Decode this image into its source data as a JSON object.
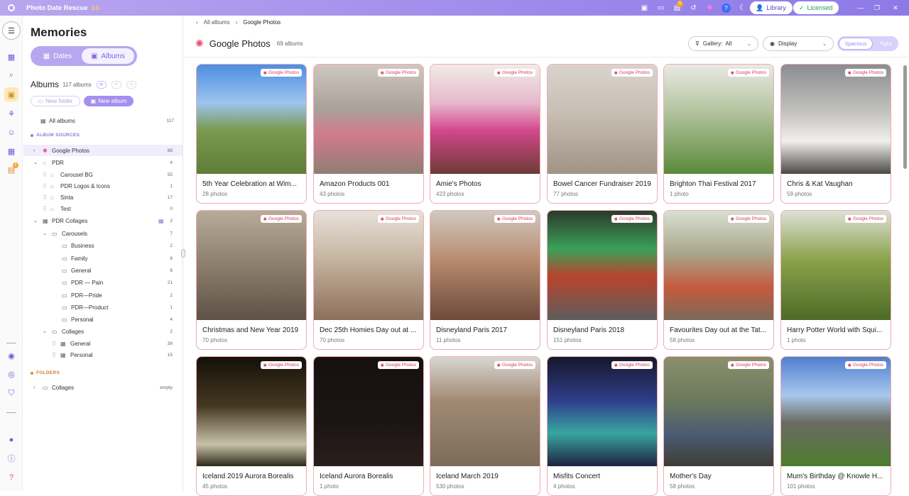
{
  "titlebar": {
    "app_name": "Photo Date Rescue",
    "version": "3.0",
    "notif_badge": "5",
    "library_label": "Library",
    "licensed_label": "Licensed"
  },
  "rail": {
    "badge": "5"
  },
  "sidebar": {
    "title": "Memories",
    "seg_dates": "Dates",
    "seg_albums": "Albums",
    "albums_title": "Albums",
    "albums_count": "117 albums",
    "new_folder": "New folder",
    "new_album": "New album",
    "all_albums": {
      "label": "All albums",
      "count": "117"
    },
    "album_sources_header": "ALBUM SOURCES",
    "folders_header": "FOLDERS",
    "tree": [
      {
        "label": "Google Photos",
        "count": "69"
      },
      {
        "label": "PDR",
        "count": "4"
      },
      {
        "label": "Carousel BG",
        "count": "55"
      },
      {
        "label": "PDR Logos & Icons",
        "count": "1"
      },
      {
        "label": "Sinta",
        "count": "17"
      },
      {
        "label": "Test",
        "count": "0"
      },
      {
        "label": "PDR Collages",
        "count": "2"
      },
      {
        "label": "Carousels",
        "count": "7"
      },
      {
        "label": "Business",
        "count": "2"
      },
      {
        "label": "Family",
        "count": "6"
      },
      {
        "label": "General",
        "count": "6"
      },
      {
        "label": "PDR — Pain",
        "count": "21"
      },
      {
        "label": "PDR—Pride",
        "count": "2"
      },
      {
        "label": "PDR—Product",
        "count": "1"
      },
      {
        "label": "Personal",
        "count": "4"
      },
      {
        "label": "Collages",
        "count": "2"
      },
      {
        "label": "General",
        "count": "38"
      },
      {
        "label": "Personal",
        "count": "15"
      }
    ],
    "folder_collages": {
      "label": "Collages",
      "count": "empty"
    }
  },
  "breadcrumb": {
    "root": "All albums",
    "current": "Google Photos"
  },
  "main": {
    "title": "Google Photos",
    "count": "69 albums",
    "gallery_label": "Gallery:",
    "gallery_value": "All",
    "display_label": "Display",
    "spacious_label": "Spacious",
    "tight_label": "Tight",
    "badge_label": "Google Photos"
  },
  "albums": [
    {
      "name": "5th Year Celebration at Wim...",
      "count": "28 photos"
    },
    {
      "name": "Amazon Products 001",
      "count": "43 photos"
    },
    {
      "name": "Amie's Photos",
      "count": "423 photos"
    },
    {
      "name": "Bowel Cancer Fundraiser 2019",
      "count": "77 photos"
    },
    {
      "name": "Brighton Thai Festival 2017",
      "count": "1 photo"
    },
    {
      "name": "Chris & Kat Vaughan",
      "count": "59 photos"
    },
    {
      "name": "Christmas and New Year 2019",
      "count": "70 photos"
    },
    {
      "name": "Dec 25th Homies Day out at ...",
      "count": "70 photos"
    },
    {
      "name": "Disneyland Paris 2017",
      "count": "11 photos"
    },
    {
      "name": "Disneyland Paris 2018",
      "count": "151 photos"
    },
    {
      "name": "Favourites Day out at the Tat...",
      "count": "58 photos"
    },
    {
      "name": "Harry Potter World with Squi...",
      "count": "1 photo"
    },
    {
      "name": "Iceland 2019 Aurora Borealis",
      "count": "45 photos"
    },
    {
      "name": "Iceland Aurora Borealis",
      "count": "1 photo"
    },
    {
      "name": "Iceland March 2019",
      "count": "530 photos"
    },
    {
      "name": "Misfits Concert",
      "count": "4 photos"
    },
    {
      "name": "Mother's Day",
      "count": "58 photos"
    },
    {
      "name": "Mum's Birthday @ Knowle H...",
      "count": "101 photos"
    }
  ],
  "colors": {
    "accent": "#9d89ea",
    "badge": "#d23c62",
    "card_border": "#f0aab5",
    "licensed": "#2e9b58"
  }
}
